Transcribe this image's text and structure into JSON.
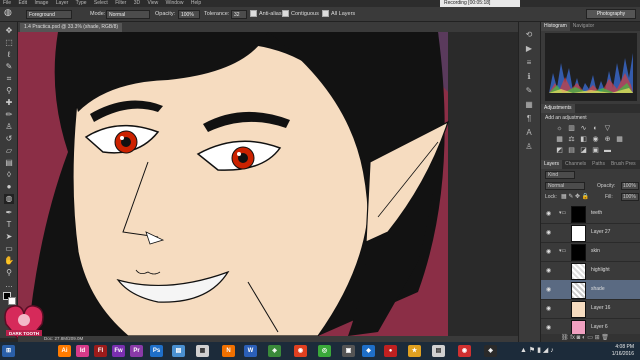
{
  "menubar": {
    "items": [
      "File",
      "Edit",
      "Image",
      "Layer",
      "Type",
      "Select",
      "Filter",
      "3D",
      "View",
      "Window",
      "Help"
    ],
    "recording_label": "Recording [00:05:18]"
  },
  "options": {
    "layer_mode_value": "Foreground",
    "mode_label": "Mode:",
    "mode_value": "Normal",
    "opacity_label": "Opacity:",
    "opacity_value": "100%",
    "tolerance_label": "Tolerance:",
    "tolerance_value": "32",
    "anti_alias_label": "Anti-alias",
    "contiguous_label": "Contiguous",
    "all_layers_label": "All Layers",
    "workspace_value": "Photography"
  },
  "document": {
    "tab_title": "1.4 Practica.psd @ 33.3% (shade, RGB/8)",
    "status_text": "Doc: 27.8M/209.0M"
  },
  "panels": {
    "histogram_tab": "Histogram",
    "navigator_tab": "Navigator",
    "adjustments_tab": "Adjustments",
    "adjustments_subtitle": "Add an adjustment",
    "layers_tab": "Layers",
    "channels_tab": "Channels",
    "paths_tab": "Paths",
    "brush_tab": "Brush Pres",
    "kind_label": "Kind",
    "blend_mode": "Normal",
    "opacity_label": "Opacity:",
    "opacity_value": "100%",
    "lock_label": "Lock:",
    "fill_label": "Fill:",
    "fill_value": "100%",
    "layers": [
      {
        "name": "teeth"
      },
      {
        "name": "Layer 27"
      },
      {
        "name": "skin"
      },
      {
        "name": "highlight"
      },
      {
        "name": "shade"
      },
      {
        "name": "Layer 16"
      },
      {
        "name": "Layer 6"
      }
    ]
  },
  "taskbar": {
    "time": "4:08 PM",
    "date": "1/16/2016"
  },
  "badge": {
    "text": "DARK TOOTH"
  },
  "colors": {
    "accent_selected": "#5a6a82",
    "canvas_bg": "#8b2e46",
    "skin": "#f6dcc0",
    "eye_red": "#cc2200"
  }
}
